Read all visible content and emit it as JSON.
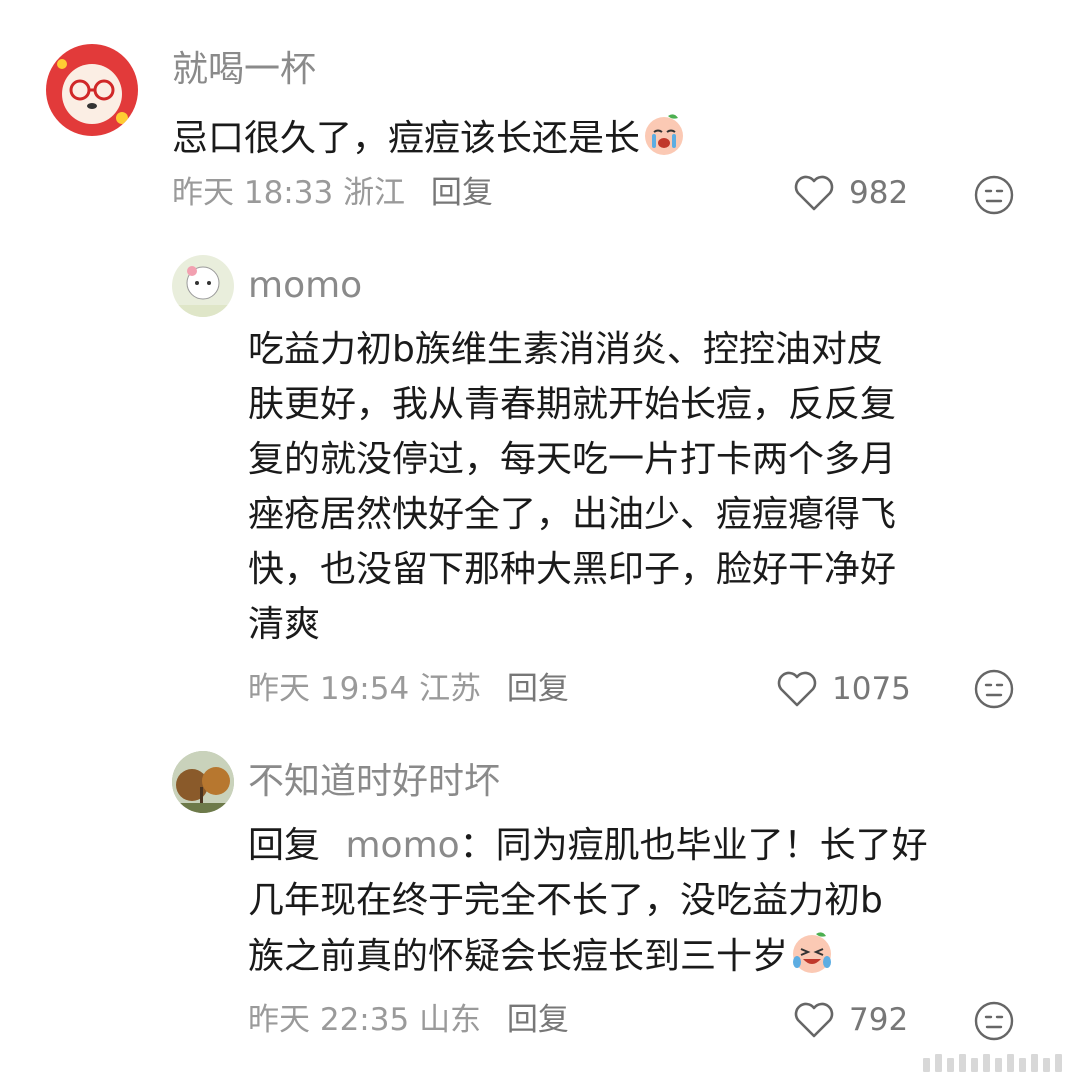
{
  "comments": [
    {
      "username": "就喝一杯",
      "text": "忌口很久了，痘痘该长还是长",
      "time": "昨天 18:33",
      "location": "浙江",
      "reply_label": "回复",
      "likes": "982",
      "text_emoji": "crying-face-emoji"
    },
    {
      "username": "momo",
      "text_lines": [
        "吃益力初b族维生素消消炎、控控油对皮",
        "肤更好，我从青春期就开始长痘，反反复",
        "复的就没停过，每天吃一片打卡两个多月",
        "痤疮居然快好全了，出油少、痘痘瘪得飞",
        "快，也没留下那种大黑印子，脸好干净好",
        "清爽"
      ],
      "time": "昨天 19:54",
      "location": "江苏",
      "reply_label": "回复",
      "likes": "1075"
    },
    {
      "username": "不知道时好时坏",
      "reply_prefix": "回复",
      "reply_to": "momo",
      "reply_colon": "：",
      "text_line1": "同为痘肌也毕业了！长了好",
      "text_lines": [
        "几年现在终于完全不长了，没吃益力初b",
        "族之前真的怀疑会长痘长到三十岁"
      ],
      "time": "昨天 22:35",
      "location": "山东",
      "reply_label": "回复",
      "likes": "792",
      "text_emoji": "laughing-crying-emoji"
    }
  ],
  "icons": {
    "like": "heart-outline-icon",
    "dislike": "neutral-face-icon"
  },
  "colors": {
    "text": "#1a1a1a",
    "muted": "#9a9a9a",
    "username": "#8a8a8a"
  }
}
